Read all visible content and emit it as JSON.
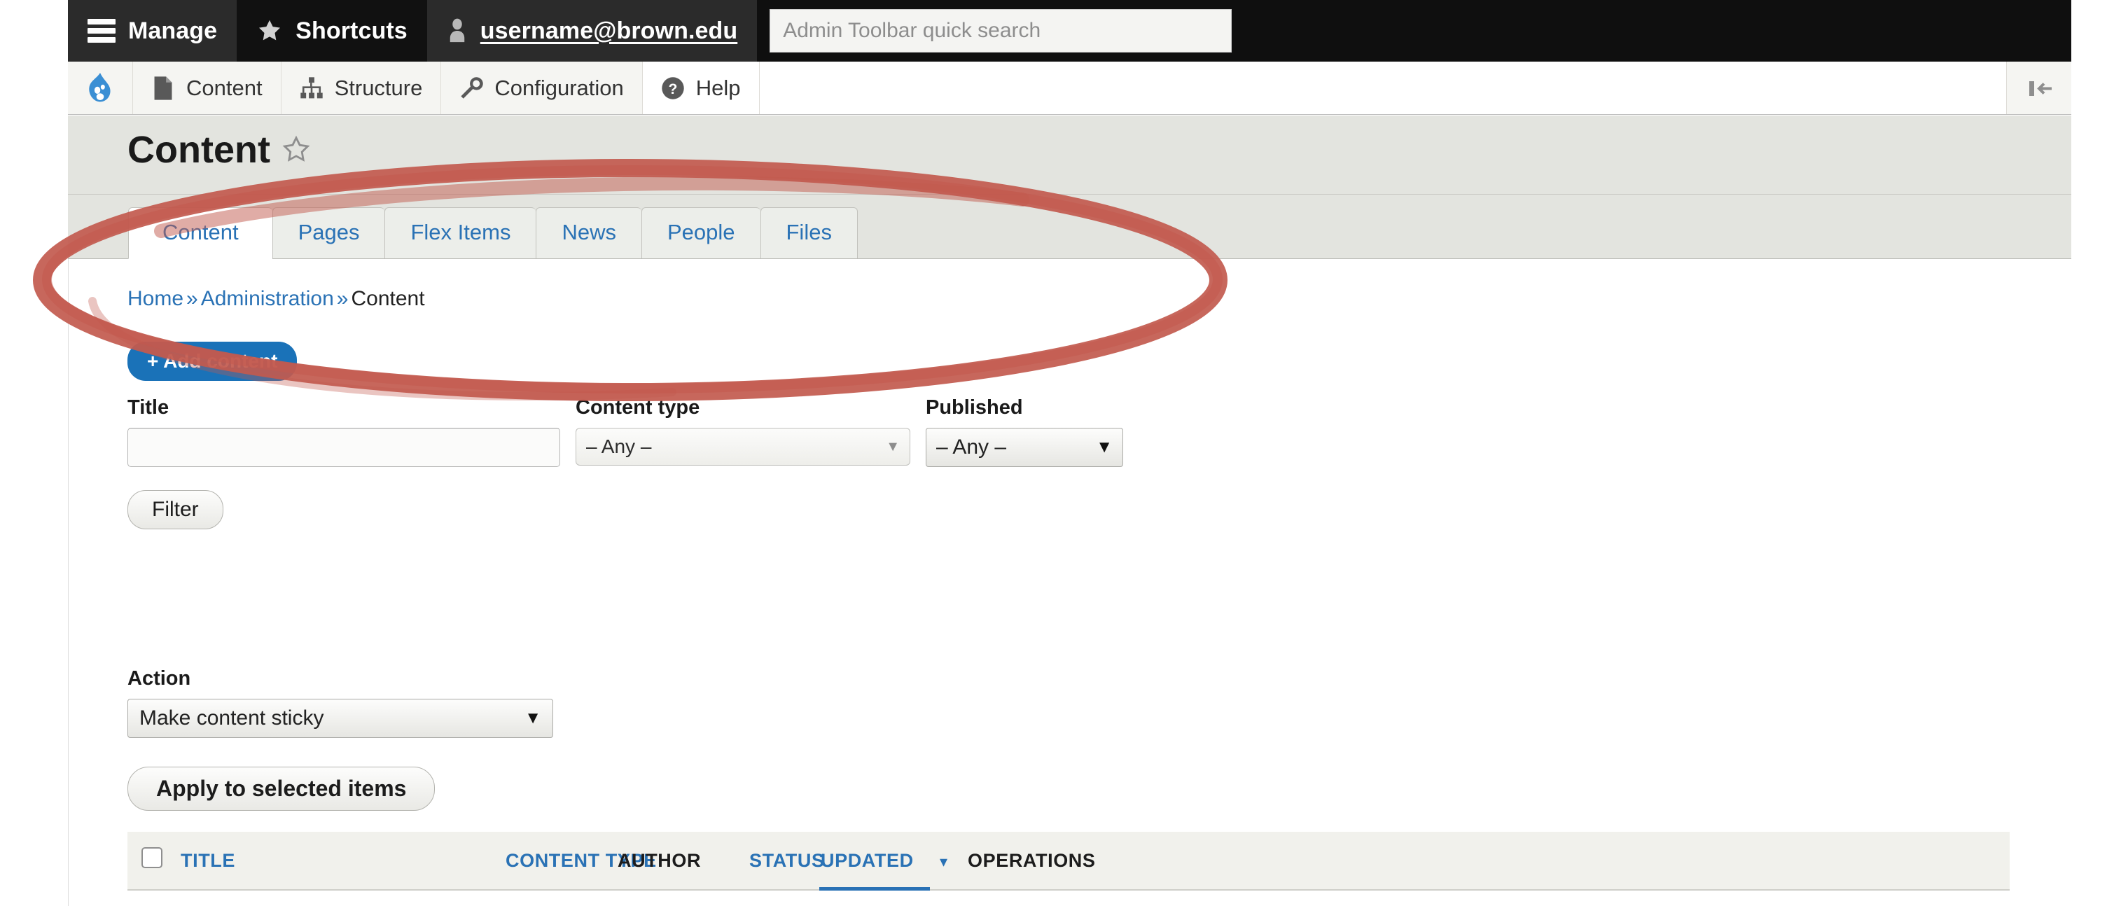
{
  "admin_toolbar": {
    "manage_label": "Manage",
    "shortcuts_label": "Shortcuts",
    "username_label": "username@brown.edu",
    "search_placeholder": "Admin Toolbar quick search",
    "search_value": ""
  },
  "menu_bar": {
    "items": [
      {
        "label": "Content",
        "icon": "document-icon"
      },
      {
        "label": "Structure",
        "icon": "sitemap-icon"
      },
      {
        "label": "Configuration",
        "icon": "wrench-icon"
      },
      {
        "label": "Help",
        "icon": "question-circle-icon"
      }
    ],
    "logo_icon": "drupal-logo-icon",
    "orientation_icon": "toolbar-orientation-icon"
  },
  "page": {
    "title": "Content",
    "favorite_icon": "star-outline-icon"
  },
  "tabs": [
    {
      "label": "Content",
      "active": true
    },
    {
      "label": "Pages",
      "active": false
    },
    {
      "label": "Flex Items",
      "active": false
    },
    {
      "label": "News",
      "active": false
    },
    {
      "label": "People",
      "active": false
    },
    {
      "label": "Files",
      "active": false
    }
  ],
  "breadcrumb": {
    "home": "Home",
    "sep1": "»",
    "administration": "Administration",
    "sep2": "»",
    "current": "Content"
  },
  "actions": {
    "add_content_label": "+ Add content"
  },
  "filters": {
    "title_label": "Title",
    "title_value": "",
    "content_type_label": "Content type",
    "content_type_value": "– Any –",
    "published_label": "Published",
    "published_value": "– Any –",
    "filter_button": "Filter"
  },
  "bulk": {
    "action_label": "Action",
    "action_value": "Make content sticky",
    "apply_button": "Apply to selected items"
  },
  "table": {
    "columns": [
      {
        "label": "TITLE",
        "sortable": true
      },
      {
        "label": "CONTENT TYPE",
        "sortable": true
      },
      {
        "label": "AUTHOR",
        "sortable": false
      },
      {
        "label": "STATUS",
        "sortable": true
      },
      {
        "label": "UPDATED",
        "sortable": true,
        "sorted": true,
        "direction": "desc"
      },
      {
        "label": "OPERATIONS",
        "sortable": false
      }
    ],
    "sort_caret": "▾",
    "rows": []
  },
  "annotation": {
    "shape": "ellipse",
    "color": "#c25a4e",
    "description": "hand-drawn red ellipse highlighting the tabs row"
  },
  "colors": {
    "toolbar_black": "#0f0f0f",
    "toolbar_gray": "#2b2b2b",
    "link_blue": "#2a72b5",
    "button_blue": "#1a72b8",
    "title_band": "#e3e4df",
    "annotation_red": "#c25a4e"
  }
}
